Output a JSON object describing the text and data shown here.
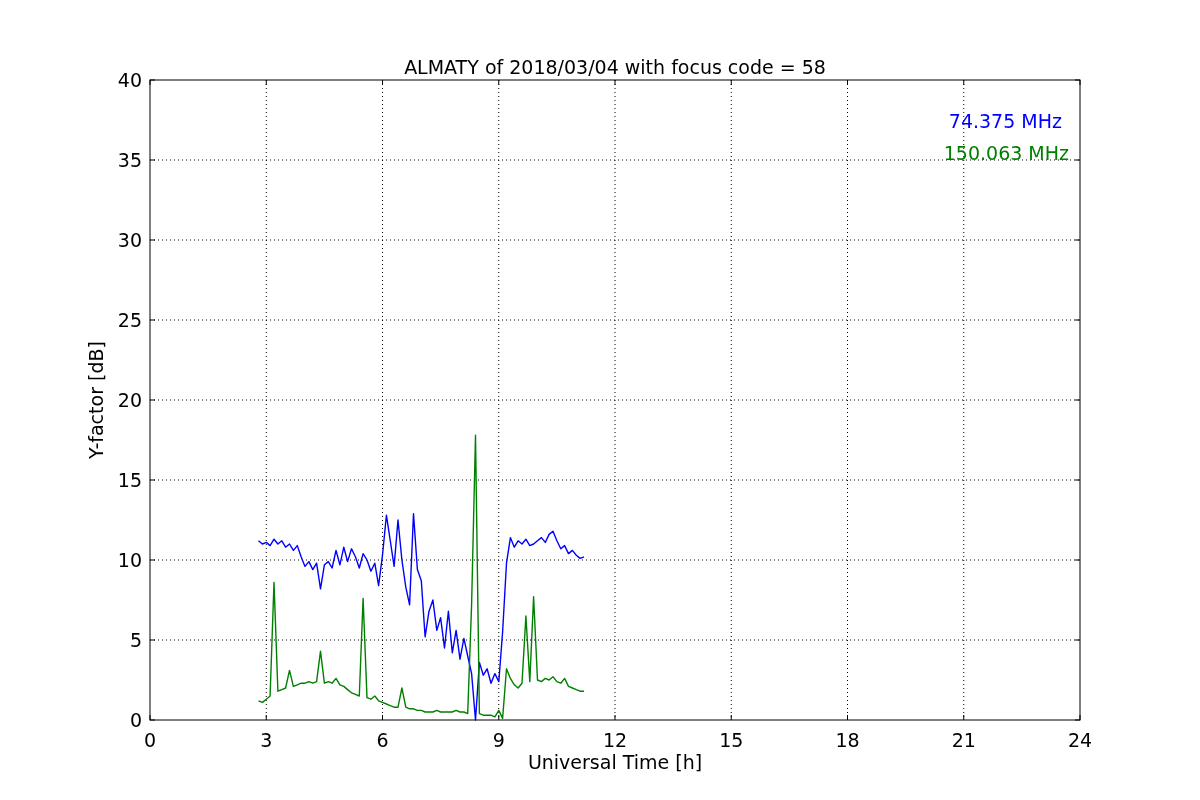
{
  "chart_data": {
    "type": "line",
    "title": "ALMATY of 2018/03/04 with focus code = 58",
    "xlabel": "Universal Time [h]",
    "ylabel": "Y-factor [dB]",
    "grid": true,
    "xlim": [
      0,
      24
    ],
    "ylim": [
      0,
      40
    ],
    "xticks": [
      0,
      3,
      6,
      9,
      12,
      15,
      18,
      21,
      24
    ],
    "yticks": [
      0,
      5,
      10,
      15,
      20,
      25,
      30,
      35,
      40
    ],
    "x": [
      2.8,
      2.9,
      3.0,
      3.1,
      3.2,
      3.3,
      3.4,
      3.5,
      3.6,
      3.7,
      3.8,
      3.9,
      4.0,
      4.1,
      4.2,
      4.3,
      4.4,
      4.5,
      4.6,
      4.7,
      4.8,
      4.9,
      5.0,
      5.1,
      5.2,
      5.3,
      5.4,
      5.5,
      5.6,
      5.7,
      5.8,
      5.9,
      6.0,
      6.1,
      6.2,
      6.3,
      6.4,
      6.5,
      6.6,
      6.7,
      6.8,
      6.9,
      7.0,
      7.1,
      7.2,
      7.3,
      7.4,
      7.5,
      7.6,
      7.7,
      7.8,
      7.9,
      8.0,
      8.1,
      8.2,
      8.3,
      8.4,
      8.5,
      8.6,
      8.7,
      8.8,
      8.9,
      9.0,
      9.1,
      9.2,
      9.3,
      9.4,
      9.5,
      9.6,
      9.7,
      9.8,
      9.9,
      10.0,
      10.1,
      10.2,
      10.3,
      10.4,
      10.5,
      10.6,
      10.7,
      10.8,
      10.9,
      11.0,
      11.1,
      11.2
    ],
    "series": [
      {
        "name": "74.375 MHz",
        "color": "#0000ff",
        "values": [
          11.2,
          11.0,
          11.1,
          10.9,
          11.3,
          11.0,
          11.2,
          10.8,
          11.0,
          10.6,
          10.9,
          10.2,
          9.6,
          9.9,
          9.4,
          9.8,
          8.2,
          9.7,
          9.9,
          9.5,
          10.6,
          9.7,
          10.8,
          9.9,
          10.7,
          10.2,
          9.5,
          10.4,
          10.0,
          9.3,
          9.8,
          8.4,
          10.3,
          12.8,
          11.2,
          9.6,
          12.5,
          10.0,
          8.3,
          7.2,
          12.9,
          9.4,
          8.7,
          5.2,
          6.8,
          7.5,
          5.6,
          6.4,
          4.5,
          6.8,
          4.2,
          5.6,
          3.8,
          5.1,
          4.0,
          2.9,
          0.0,
          3.6,
          2.8,
          3.2,
          2.3,
          2.9,
          2.4,
          5.5,
          9.8,
          11.4,
          10.8,
          11.2,
          11.0,
          11.3,
          10.9,
          11.0,
          11.2,
          11.4,
          11.1,
          11.6,
          11.8,
          11.2,
          10.7,
          10.9,
          10.4,
          10.6,
          10.3,
          10.1,
          10.2
        ]
      },
      {
        "name": "150.063 MHz",
        "color": "#008000",
        "values": [
          1.2,
          1.1,
          1.3,
          1.5,
          8.6,
          1.8,
          1.9,
          2.0,
          3.1,
          2.1,
          2.2,
          2.3,
          2.3,
          2.4,
          2.3,
          2.4,
          4.3,
          2.3,
          2.4,
          2.3,
          2.6,
          2.2,
          2.1,
          1.9,
          1.7,
          1.6,
          1.5,
          7.6,
          1.4,
          1.3,
          1.5,
          1.2,
          1.1,
          1.0,
          0.9,
          0.8,
          0.8,
          2.0,
          0.8,
          0.7,
          0.7,
          0.6,
          0.6,
          0.5,
          0.5,
          0.5,
          0.6,
          0.5,
          0.5,
          0.5,
          0.5,
          0.6,
          0.5,
          0.5,
          0.4,
          7.2,
          17.8,
          0.4,
          0.3,
          0.3,
          0.3,
          0.2,
          0.6,
          0.1,
          3.2,
          2.6,
          2.2,
          2.0,
          2.3,
          6.5,
          2.4,
          7.7,
          2.5,
          2.4,
          2.6,
          2.5,
          2.7,
          2.4,
          2.3,
          2.6,
          2.1,
          2.0,
          1.9,
          1.8,
          1.8
        ]
      }
    ]
  }
}
